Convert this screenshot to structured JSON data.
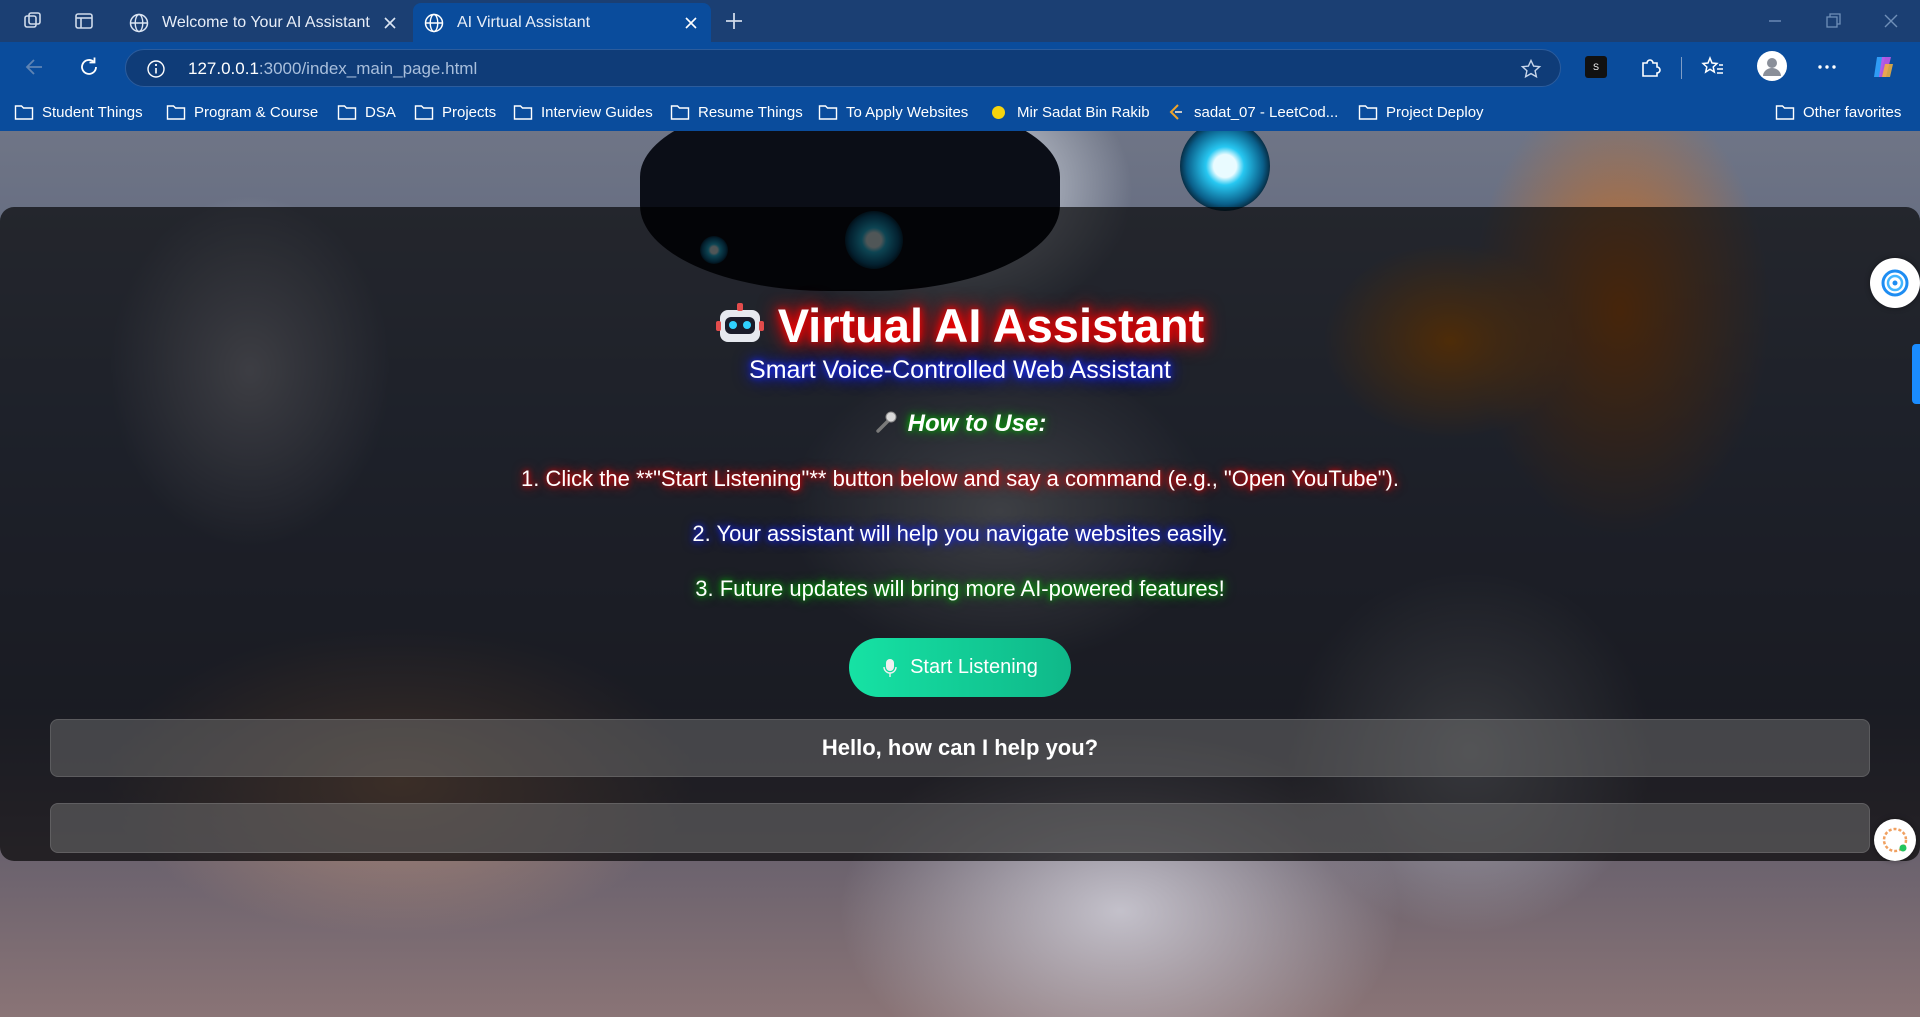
{
  "browser": {
    "tabs": [
      {
        "label": "Welcome to Your AI Assistant",
        "icon": "globe-icon",
        "active": false
      },
      {
        "label": "AI Virtual Assistant",
        "icon": "globe-icon",
        "active": true
      }
    ],
    "url": {
      "host": "127.0.0.1",
      "rest": ":3000/index_main_page.html"
    },
    "bookmarks": [
      {
        "label": "Student Things",
        "icon": "folder-icon"
      },
      {
        "label": "Program & Course",
        "icon": "folder-icon"
      },
      {
        "label": "DSA",
        "icon": "folder-icon"
      },
      {
        "label": "Projects",
        "icon": "folder-icon"
      },
      {
        "label": "Interview Guides",
        "icon": "folder-icon"
      },
      {
        "label": "Resume Things",
        "icon": "folder-icon"
      },
      {
        "label": "To Apply Websites",
        "icon": "folder-icon"
      },
      {
        "label": "Mir Sadat Bin Rakib",
        "icon": "yellow-dot-icon"
      },
      {
        "label": "sadat_07 - LeetCod...",
        "icon": "leetcode-icon"
      },
      {
        "label": "Project Deploy",
        "icon": "folder-icon"
      }
    ],
    "other_favorites": "Other favorites",
    "accent_color": "#0a4c9c"
  },
  "page": {
    "title": "Virtual AI Assistant",
    "subtitle": "Smart Voice-Controlled Web Assistant",
    "how_to": "How to Use:",
    "steps": [
      "1. Click the **\"Start Listening\"** button below and say a command (e.g., \"Open YouTube\").",
      "2. Your assistant will help you navigate websites easily.",
      "3. Future updates will bring more AI-powered features!"
    ],
    "button_label": "Start Listening",
    "greeting": "Hello, how can I help you?",
    "output": "",
    "button_color": "#16e2a4"
  }
}
